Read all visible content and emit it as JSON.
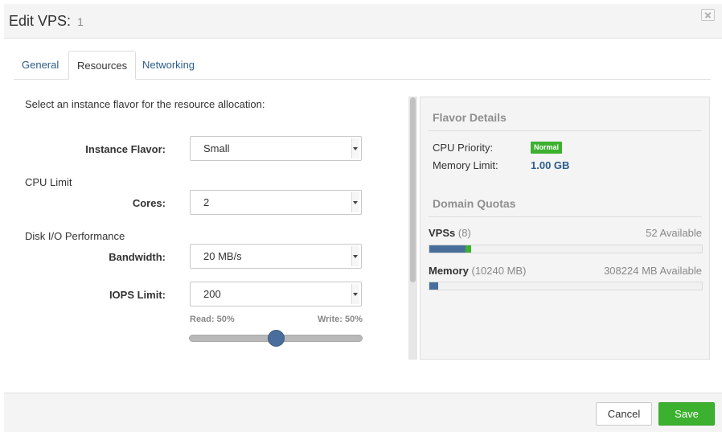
{
  "dialog": {
    "title": "Edit VPS:",
    "subtitle": "1"
  },
  "tabs": [
    {
      "label": "General"
    },
    {
      "label": "Resources"
    },
    {
      "label": "Networking"
    }
  ],
  "resources": {
    "instruction": "Select an instance flavor for the resource allocation:",
    "instance_flavor": {
      "label": "Instance Flavor:",
      "value": "Small"
    },
    "cpu_section": "CPU Limit",
    "cores": {
      "label": "Cores:",
      "value": "2"
    },
    "disk_section": "Disk I/O Performance",
    "bandwidth": {
      "label": "Bandwidth:",
      "value": "20 MB/s"
    },
    "iops": {
      "label": "IOPS Limit:",
      "value": "200"
    },
    "slider": {
      "read_label": "Read: 50%",
      "write_label": "Write: 50%",
      "value_percent": 50
    }
  },
  "flavor_details": {
    "heading": "Flavor Details",
    "cpu_priority_label": "CPU Priority:",
    "cpu_priority_value": "Normal",
    "memory_limit_label": "Memory Limit:",
    "memory_limit_value": "1.00 GB"
  },
  "domain_quotas": {
    "heading": "Domain Quotas",
    "vps": {
      "label": "VPSs",
      "count": "(8)",
      "available": "52 Available",
      "used_fraction": 0.133,
      "new_fraction": 0.02
    },
    "memory": {
      "label": "Memory",
      "count": "(10240 MB)",
      "available": "308224 MB Available",
      "used_fraction": 0.032
    }
  },
  "footer": {
    "cancel_label": "Cancel",
    "save_label": "Save"
  },
  "colors": {
    "accent": "#2c5d8a",
    "success": "#3cb130",
    "bar_used": "#4a6e9b"
  }
}
